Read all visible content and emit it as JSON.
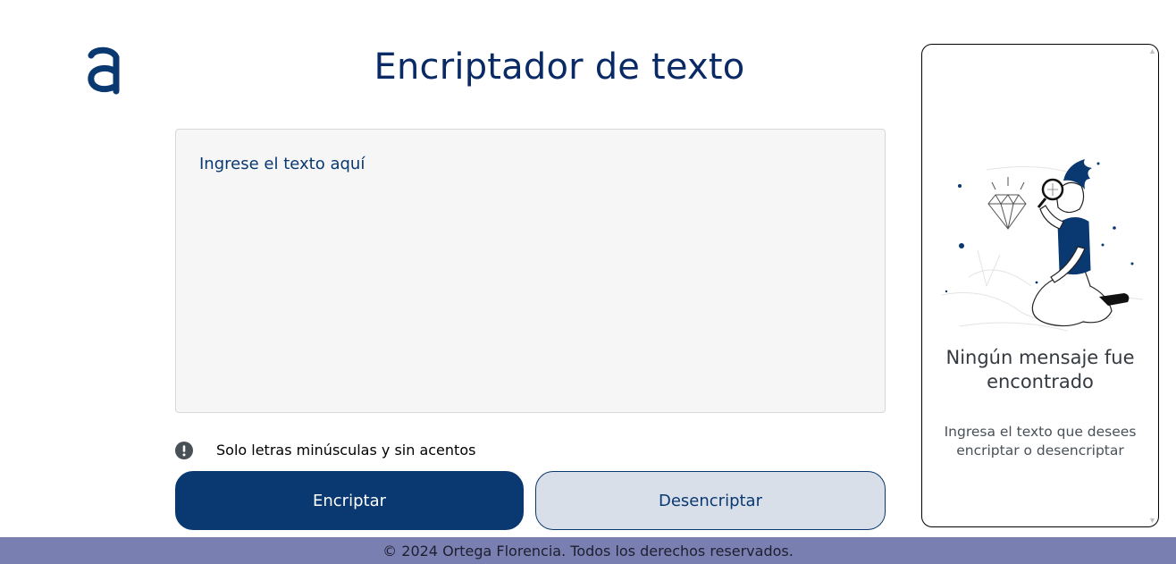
{
  "header": {
    "logo_alt": "Alura logo",
    "title": "Encriptador de texto"
  },
  "input": {
    "placeholder": "Ingrese el texto aquí",
    "value": ""
  },
  "hint": {
    "icon": "exclamation-circle-icon",
    "text": "Solo letras minúsculas y sin acentos"
  },
  "buttons": {
    "encrypt_label": "Encriptar",
    "decrypt_label": "Desencriptar"
  },
  "output": {
    "illustration": "person-with-magnifier-illustration",
    "empty_title": "Ningún mensaje fue encontrado",
    "empty_subtitle": "Ingresa el texto que desees encriptar o desencriptar"
  },
  "footer": {
    "text": "© 2024 Ortega Florencia. Todos los derechos reservados."
  },
  "colors": {
    "primary": "#0a3871",
    "secondary_button": "#d8dfe8",
    "footer_bg": "#7a7fb1",
    "input_bg": "#f6f6f6"
  }
}
